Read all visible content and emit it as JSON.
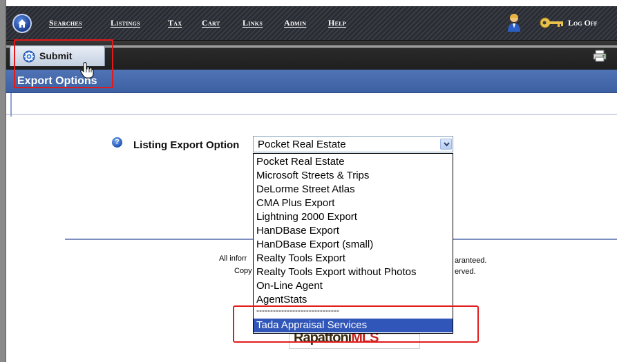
{
  "navbar": {
    "items": [
      {
        "label": "Searches"
      },
      {
        "label": "Listings"
      },
      {
        "label": "Tax"
      },
      {
        "label": "Cart"
      },
      {
        "label": "Links"
      },
      {
        "label": "Admin"
      },
      {
        "label": "Help"
      }
    ],
    "logoff_label": "Log Off"
  },
  "toolbar": {
    "submit_label": "Submit"
  },
  "section": {
    "title": "Export Options"
  },
  "form": {
    "field_label": "Listing Export Option",
    "selected_value": "Pocket Real Estate",
    "options": [
      "Pocket Real Estate",
      "Microsoft Streets & Trips",
      "DeLorme Street Atlas",
      "CMA Plus Export",
      "Lightning 2000 Export",
      "HanDBase Export",
      "HanDBase Export (small)",
      "Realty Tools Export",
      "Realty Tools Export without Photos",
      "On-Line Agent",
      "AgentStats",
      "------------------------------",
      "Tada Appraisal Services"
    ],
    "highlighted_option_index": 12
  },
  "footer": {
    "line1_left": "All inforr",
    "line1_right": "aranteed.",
    "line2_left": "Copy",
    "line2_right": "erved."
  },
  "colors": {
    "accent_blue": "#3d60a3",
    "selection": "#3056b9",
    "highlight_red": "#e11b1b"
  }
}
